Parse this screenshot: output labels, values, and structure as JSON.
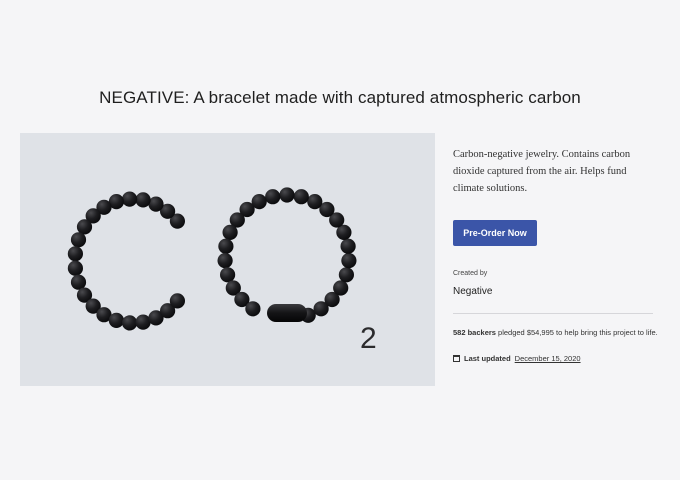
{
  "page": {
    "title": "NEGATIVE: A bracelet made with captured atmospheric carbon"
  },
  "hero": {
    "subscript": "2",
    "alt_icon": "co2-bracelets-image"
  },
  "sidebar": {
    "description": "Carbon-negative jewelry. Contains carbon dioxide captured from the air. Helps fund climate solutions.",
    "cta_label": "Pre-Order Now",
    "created_by_label": "Created by",
    "creator_name": "Negative",
    "backers_count": "582 backers",
    "backers_rest": " pledged $54,995 to help bring this project to life.",
    "last_updated_label": "Last updated",
    "last_updated_date": "December 15, 2020",
    "calendar_icon": "calendar-icon"
  },
  "colors": {
    "accent": "#3b55a8",
    "background": "#f5f5f7",
    "hero_bg": "#dfe2e7",
    "bead": "#1c1c1e"
  }
}
